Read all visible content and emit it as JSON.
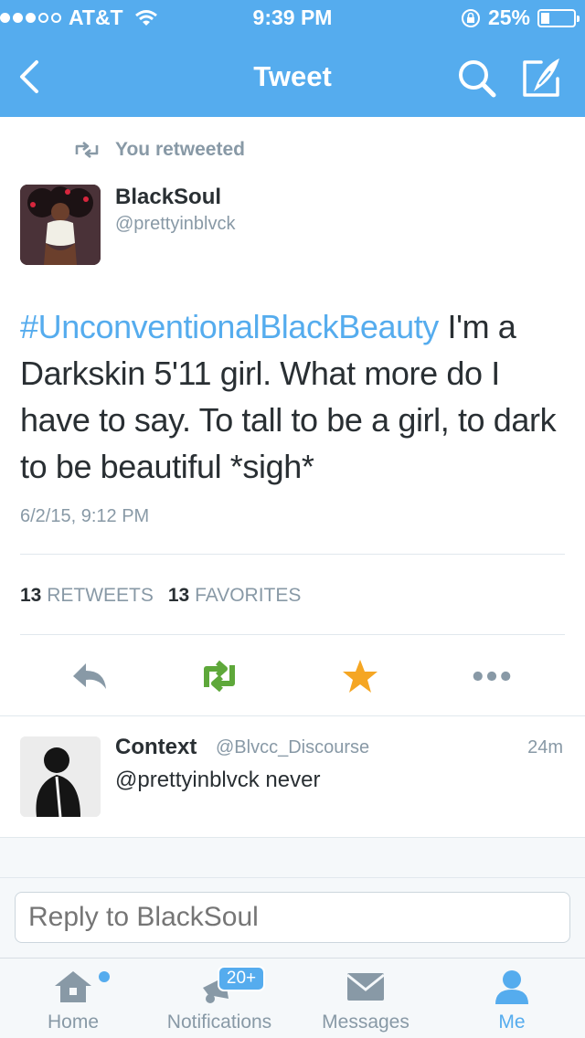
{
  "status_bar": {
    "carrier": "AT&T",
    "time": "9:39 PM",
    "battery_label": "25%",
    "battery_level": 0.25
  },
  "nav": {
    "title": "Tweet",
    "icons": [
      "back-chevron-icon",
      "search-icon",
      "compose-icon"
    ]
  },
  "tweet": {
    "retweet_context": "You retweeted",
    "author_name": "BlackSoul",
    "author_handle": "@prettyinblvck",
    "hashtag": "#UnconventionalBlackBeauty",
    "text": " I'm a Darkskin 5'11 girl. What more do I have to say. To tall to be a girl, to dark to be beautiful *sigh*",
    "date": "6/2/15, 9:12 PM",
    "retweets_count": "13",
    "retweets_label": "RETWEETS",
    "favorites_count": "13",
    "favorites_label": "FAVORITES",
    "actions": [
      "reply-icon",
      "retweet-icon",
      "favorite-star-icon",
      "more-icon"
    ],
    "colors": {
      "retweet": "#5ea83a",
      "favorite": "#f5a623",
      "link": "#55acee"
    }
  },
  "reply": {
    "name": "Context",
    "handle": "@Blvcc_Discourse",
    "time": "24m",
    "text": "@prettyinblvck never"
  },
  "composer": {
    "placeholder": "Reply to BlackSoul"
  },
  "tabs": [
    {
      "label": "Home",
      "icon": "home-icon",
      "active": false
    },
    {
      "label": "Notifications",
      "icon": "notifications-icon",
      "badge": "20+",
      "active": false
    },
    {
      "label": "Messages",
      "icon": "messages-icon",
      "active": false
    },
    {
      "label": "Me",
      "icon": "profile-icon",
      "active": true
    }
  ],
  "colors": {
    "brand": "#55acee",
    "secondary_text": "#8899a6",
    "primary_text": "#292f33"
  }
}
